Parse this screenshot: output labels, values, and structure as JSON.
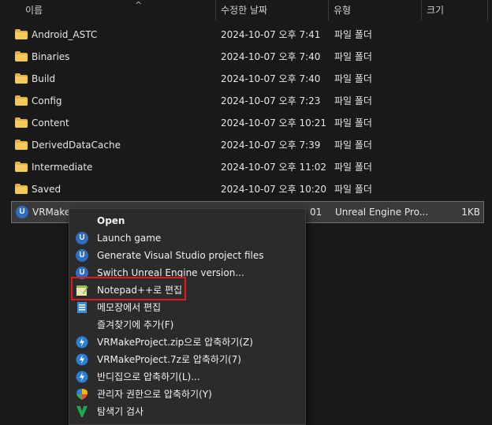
{
  "columns": {
    "name": "이름",
    "date": "수정한 날짜",
    "type": "유형",
    "size": "크기"
  },
  "rows": [
    {
      "name": "Android_ASTC",
      "date": "2024-10-07 오후 7:41",
      "type": "파일 폴더",
      "size": ""
    },
    {
      "name": "Binaries",
      "date": "2024-10-07 오후 7:40",
      "type": "파일 폴더",
      "size": ""
    },
    {
      "name": "Build",
      "date": "2024-10-07 오후 7:40",
      "type": "파일 폴더",
      "size": ""
    },
    {
      "name": "Config",
      "date": "2024-10-07 오후 7:23",
      "type": "파일 폴더",
      "size": ""
    },
    {
      "name": "Content",
      "date": "2024-10-07 오후 10:21",
      "type": "파일 폴더",
      "size": ""
    },
    {
      "name": "DerivedDataCache",
      "date": "2024-10-07 오후 7:39",
      "type": "파일 폴더",
      "size": ""
    },
    {
      "name": "Intermediate",
      "date": "2024-10-07 오후 11:02",
      "type": "파일 폴더",
      "size": ""
    },
    {
      "name": "Saved",
      "date": "2024-10-07 오후 10:20",
      "type": "파일 폴더",
      "size": ""
    }
  ],
  "selected_row": {
    "name": "VRMake",
    "date_fragment": "01",
    "type": "Unreal Engine Pro...",
    "size": "1KB"
  },
  "context_menu": [
    {
      "label": "Open",
      "icon": "none",
      "bold": true
    },
    {
      "label": "Launch game",
      "icon": "unreal-engine-icon"
    },
    {
      "label": "Generate Visual Studio project files",
      "icon": "unreal-engine-icon"
    },
    {
      "label": "Switch Unreal Engine version...",
      "icon": "unreal-engine-icon"
    },
    {
      "label": "Notepad++로 편집",
      "icon": "notepad-plus-plus-icon"
    },
    {
      "label": "메모장에서 편집",
      "icon": "notepad-icon"
    },
    {
      "label": "즐겨찾기에 추가(F)",
      "icon": "none"
    },
    {
      "label": "VRMakeProject.zip으로 압축하기(Z)",
      "icon": "bandizip-icon"
    },
    {
      "label": "VRMakeProject.7z로 압축하기(7)",
      "icon": "bandizip-icon"
    },
    {
      "label": "반디집으로 압축하기(L)...",
      "icon": "bandizip-icon"
    },
    {
      "label": "관리자 권한으로 압축하기(Y)",
      "icon": "admin-shield-icon"
    },
    {
      "label": "탐색기 검사",
      "icon": "v3-scan-icon"
    }
  ],
  "colors": {
    "background": "#191919",
    "menu": "#2b2b2b",
    "folder": "#e8b03f",
    "highlight": "#e01b1b",
    "unreal": "#2f6dc2"
  }
}
